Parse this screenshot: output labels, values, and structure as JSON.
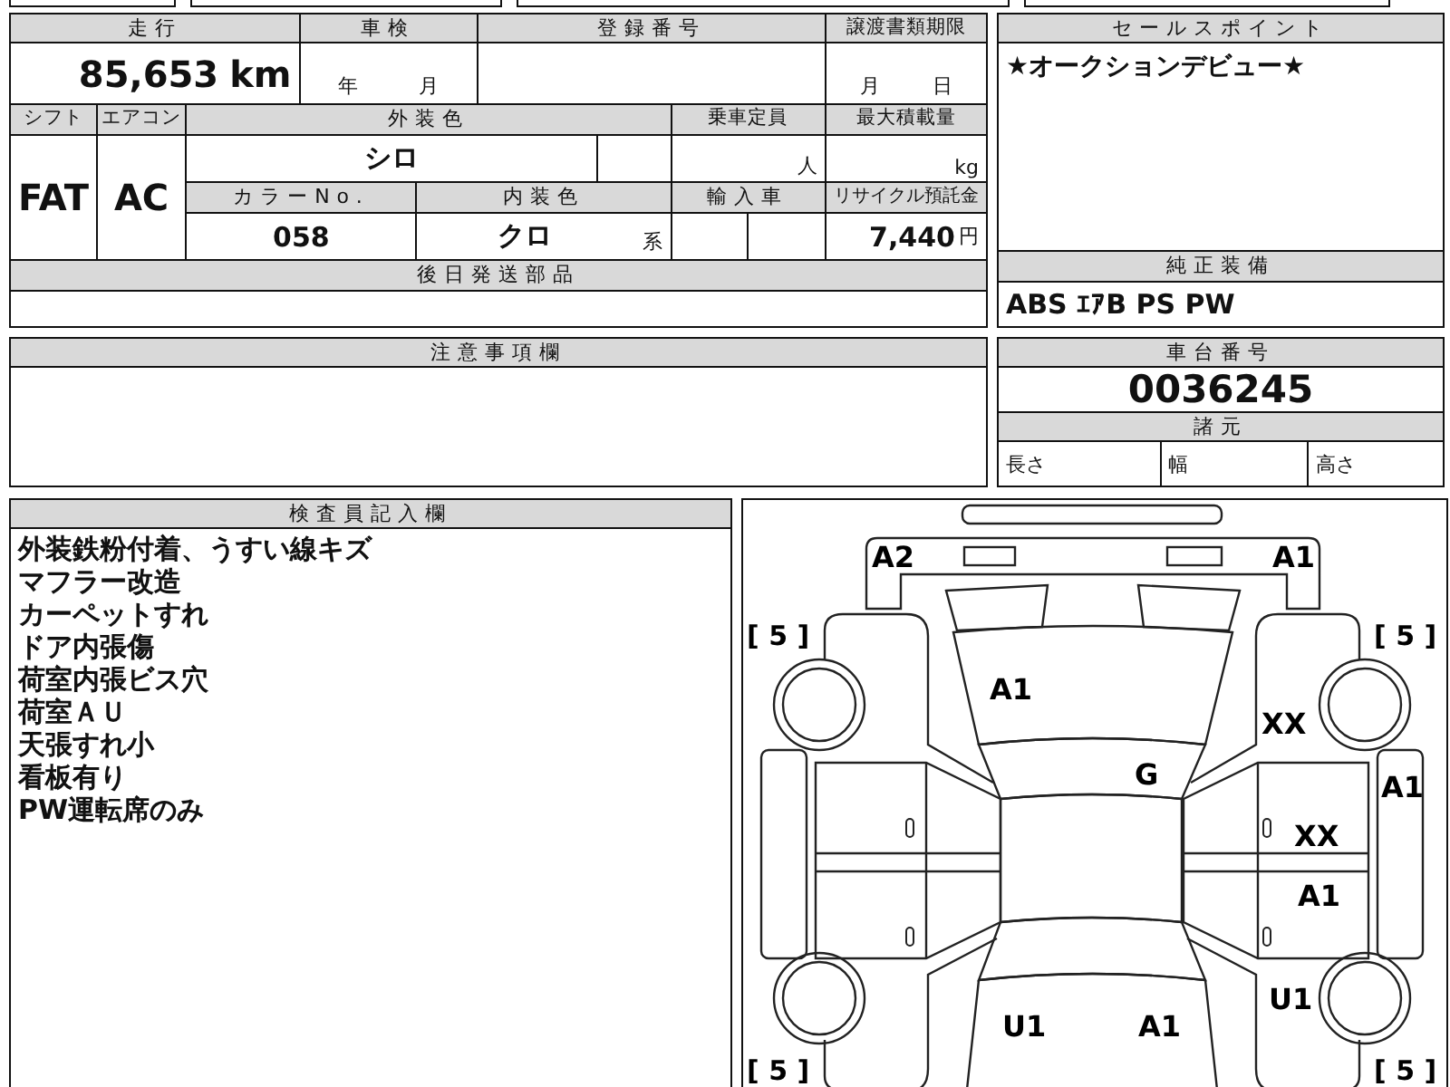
{
  "sheet": {
    "mileage": {
      "label": "走行",
      "value": "85,653",
      "unit": "km"
    },
    "inspection": {
      "label": "車検",
      "year_unit": "年",
      "month_unit": "月"
    },
    "registration_number": {
      "label": "登録番号"
    },
    "transfer_deadline": {
      "label": "譲渡書類期限",
      "month_unit": "月",
      "day_unit": "日"
    },
    "shift": {
      "label": "シフト",
      "value": "FAT"
    },
    "aircon": {
      "label": "エアコン",
      "value": "AC"
    },
    "exterior_color": {
      "label": "外装色",
      "value": "シロ"
    },
    "capacity": {
      "label": "乗車定員",
      "unit": "人"
    },
    "max_load": {
      "label": "最大積載量",
      "unit": "kg"
    },
    "color_no": {
      "label": "カラーNo.",
      "value": "058"
    },
    "interior_color": {
      "label": "内装色",
      "value": "クロ",
      "suffix": "系"
    },
    "imported": {
      "label": "輸入車"
    },
    "recycling_fee": {
      "label": "リサイクル預託金",
      "value": "7,440",
      "unit": "円"
    },
    "later_parts": {
      "label": "後日発送部品"
    }
  },
  "sale_points": {
    "label": "セールスポイント",
    "text": "★オークションデビュー★"
  },
  "standard_equipment": {
    "label": "純正装備",
    "value": "ABS ｴｱB PS PW"
  },
  "chassis": {
    "label": "車台番号",
    "value": "0036245",
    "specs_label": "諸元",
    "specs": [
      "長さ",
      "幅",
      "高さ"
    ]
  },
  "notes": {
    "label": "注意事項欄"
  },
  "inspector": {
    "label": "検査員記入欄",
    "lines": [
      "外装鉄粉付着、うすい線キズ",
      "マフラー改造",
      "カーペットすれ",
      "ドア内張傷",
      "荷室内張ビス穴",
      "荷室ＡＵ",
      "天張すれ小",
      "看板有り",
      "PW運転席のみ"
    ]
  },
  "diagram": {
    "tire_marks": [
      "[ 5 ]",
      "[ 5 ]",
      "[ 5 ]",
      "[ 5 ]"
    ],
    "damage_marks": [
      "A2",
      "A1",
      "A1",
      "XX",
      "G",
      "A1",
      "XX",
      "A1",
      "U1",
      "A1",
      "U1"
    ]
  }
}
